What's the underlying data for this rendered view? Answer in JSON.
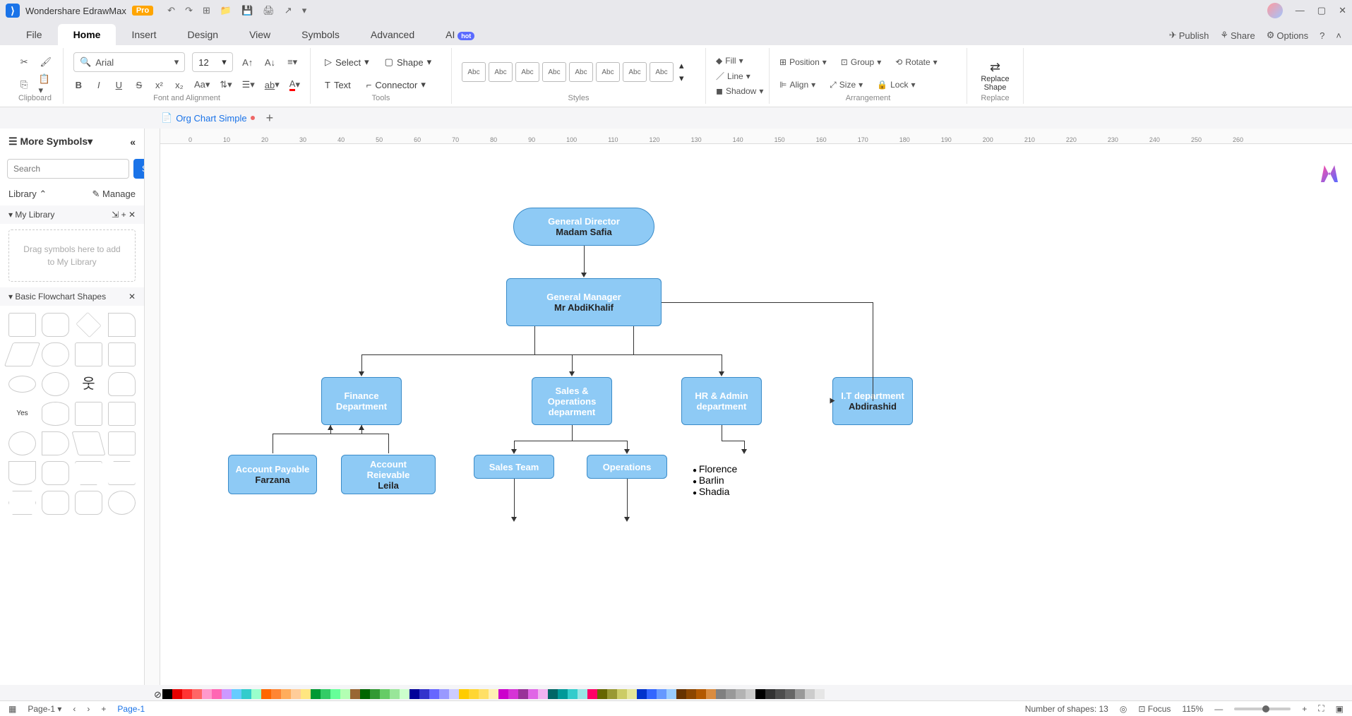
{
  "title": {
    "app": "Wondershare EdrawMax",
    "badge": "Pro"
  },
  "menus": [
    "File",
    "Home",
    "Insert",
    "Design",
    "View",
    "Symbols",
    "Advanced",
    "AI"
  ],
  "menu_right": {
    "publish": "Publish",
    "share": "Share",
    "options": "Options"
  },
  "ribbon": {
    "clipboard": "Clipboard",
    "font_align": "Font and Alignment",
    "tools": "Tools",
    "styles": "Styles",
    "arrangement": "Arrangement",
    "replace_group": "Replace",
    "font": "Arial",
    "size": "12",
    "select": "Select",
    "shape": "Shape",
    "text": "Text",
    "connector": "Connector",
    "fill": "Fill",
    "line": "Line",
    "shadow": "Shadow",
    "position": "Position",
    "align": "Align",
    "group": "Group",
    "size_btn": "Size",
    "rotate": "Rotate",
    "lock": "Lock",
    "replace": "Replace\nShape",
    "swatch": "Abc"
  },
  "doc": {
    "name": "Org Chart Simple"
  },
  "sidebar": {
    "more": "More Symbols",
    "search_ph": "Search",
    "search_btn": "Search",
    "library": "Library",
    "manage": "Manage",
    "mylib": "My Library",
    "drop": "Drag symbols here to add to My Library",
    "basic": "Basic Flowchart Shapes"
  },
  "chart": {
    "n1": {
      "t": "General Director",
      "s": "Madam Safia"
    },
    "n2": {
      "t": "General Manager",
      "s": "Mr AbdiKhalif"
    },
    "n3": {
      "t": "Finance Department"
    },
    "n4": {
      "t": "Sales & Operations deparment"
    },
    "n5": {
      "t": "HR & Admin department"
    },
    "n6": {
      "t": "I.T department",
      "s": "Abdirashid"
    },
    "n7": {
      "t": "Account Payable",
      "s": "Farzana"
    },
    "n8": {
      "t": "Account Reievable",
      "s": "Leila"
    },
    "n9": {
      "t": "Sales Team"
    },
    "n10": {
      "t": "Operations"
    },
    "hr": [
      "Florence",
      "Barlin",
      "Shadia"
    ]
  },
  "ruler": [
    "0",
    "10",
    "20",
    "30",
    "40",
    "50",
    "60",
    "70",
    "80",
    "90",
    "100",
    "110",
    "120",
    "130",
    "140",
    "150",
    "160",
    "170",
    "180",
    "190",
    "200",
    "210",
    "220",
    "230",
    "240",
    "250",
    "260"
  ],
  "colors": [
    "#000",
    "#e60000",
    "#ff3333",
    "#ff6666",
    "#ff99cc",
    "#ff66b3",
    "#cc99ff",
    "#66ccff",
    "#33cccc",
    "#99ffcc",
    "#ff6600",
    "#ff8533",
    "#ffad5c",
    "#ffcc99",
    "#ffe680",
    "#009933",
    "#33cc66",
    "#66ff99",
    "#b3ffb3",
    "#996633",
    "#006600",
    "#339933",
    "#66cc66",
    "#99e699",
    "#ccffcc",
    "#000099",
    "#3333cc",
    "#6666ff",
    "#9999ff",
    "#ccccff",
    "#ffcc00",
    "#ffd633",
    "#ffe066",
    "#fff0b3",
    "#cc00cc",
    "#d633d6",
    "#993399",
    "#e066e6",
    "#f0b3f0",
    "#006666",
    "#009999",
    "#33cccc",
    "#99e6e6",
    "#ff0066",
    "#666600",
    "#999933",
    "#cccc66",
    "#e6e699",
    "#0033cc",
    "#3366ff",
    "#6699ff",
    "#99ccff",
    "#663300",
    "#8c4600",
    "#b35900",
    "#d98c40",
    "#808080",
    "#999999",
    "#b3b3b3",
    "#cccccc",
    "#000000",
    "#333333",
    "#4d4d4d",
    "#666666",
    "#999999",
    "#cccccc",
    "#e6e6e6"
  ],
  "status": {
    "page": "Page-1",
    "page_tab": "Page-1",
    "shapes": "Number of shapes: 13",
    "focus": "Focus",
    "zoom": "115%"
  }
}
